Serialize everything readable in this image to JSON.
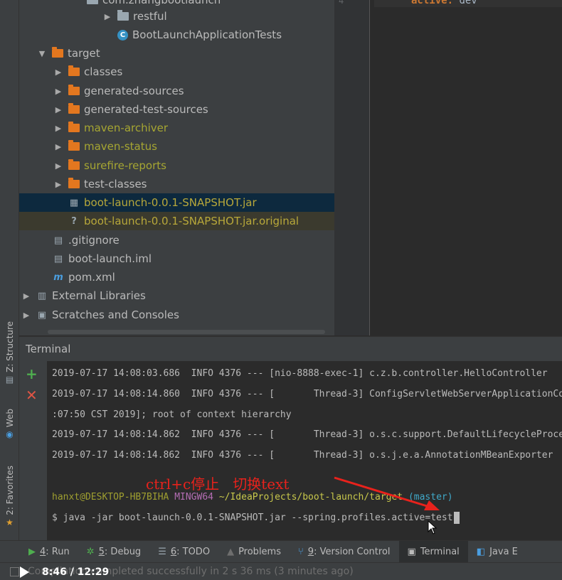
{
  "left_stripe": {
    "structure_label": "Z: Structure",
    "web_label": "Web",
    "favorites_label": "2: Favorites"
  },
  "project_tree": {
    "partial_top_row": "com.zhangbootlaunch",
    "rows": [
      {
        "label": "restful",
        "arrow": "▶",
        "icon": "package",
        "style": "normal"
      },
      {
        "label": "BootLaunchApplicationTests",
        "arrow": "",
        "icon": "class",
        "style": "normal"
      },
      {
        "label": "target",
        "arrow": "▼",
        "icon": "folder-orange",
        "style": "normal"
      },
      {
        "label": "classes",
        "arrow": "▶",
        "icon": "folder-orange",
        "style": "normal"
      },
      {
        "label": "generated-sources",
        "arrow": "▶",
        "icon": "folder-orange",
        "style": "normal"
      },
      {
        "label": "generated-test-sources",
        "arrow": "▶",
        "icon": "folder-orange",
        "style": "normal"
      },
      {
        "label": "maven-archiver",
        "arrow": "▶",
        "icon": "folder-orange",
        "style": "ignored"
      },
      {
        "label": "maven-status",
        "arrow": "▶",
        "icon": "folder-orange",
        "style": "ignored"
      },
      {
        "label": "surefire-reports",
        "arrow": "▶",
        "icon": "folder-orange",
        "style": "ignored"
      },
      {
        "label": "test-classes",
        "arrow": "▶",
        "icon": "folder-orange",
        "style": "normal"
      },
      {
        "label": "boot-launch-0.0.1-SNAPSHOT.jar",
        "arrow": "",
        "icon": "jar",
        "style": "selected"
      },
      {
        "label": "boot-launch-0.0.1-SNAPSHOT.jar.original",
        "arrow": "",
        "icon": "unknown-file",
        "style": "ignored-sel"
      },
      {
        "label": ".gitignore",
        "arrow": "",
        "icon": "text-file",
        "style": "normal"
      },
      {
        "label": "boot-launch.iml",
        "arrow": "",
        "icon": "iml-file",
        "style": "normal"
      },
      {
        "label": "pom.xml",
        "arrow": "",
        "icon": "maven",
        "style": "normal"
      },
      {
        "label": "External Libraries",
        "arrow": "▶",
        "icon": "libraries",
        "style": "normal"
      },
      {
        "label": "Scratches and Consoles",
        "arrow": "▶",
        "icon": "scratches",
        "style": "normal"
      }
    ]
  },
  "editor": {
    "line_number": "4",
    "code_key": "active:",
    "code_value": " dev"
  },
  "terminal": {
    "title": "Terminal",
    "lines": [
      "2019-07-17 14:08:03.686  INFO 4376 --- [nio-8888-exec-1] c.z.b.controller.HelloController",
      "2019-07-17 14:08:14.860  INFO 4376 --- [       Thread-3] ConfigServletWebServerApplicationContext",
      ":07:50 CST 2019]; root of context hierarchy",
      "2019-07-17 14:08:14.862  INFO 4376 --- [       Thread-3] o.s.c.support.DefaultLifecycleProcessor",
      "2019-07-17 14:08:14.862  INFO 4376 --- [       Thread-3] o.s.j.e.a.AnnotationMBeanExporter"
    ],
    "prompt": {
      "user_host": "hanxt@DESKTOP-HB7BIHA",
      "shell": "MINGW64",
      "path": "~/IdeaProjects/boot-launch/target",
      "branch": "(master)"
    },
    "command": "$ java -jar boot-launch-0.0.1-SNAPSHOT.jar --spring.profiles.active=test"
  },
  "annotation": {
    "text": "ctrl+c停止   切换text",
    "color": "#e8221c"
  },
  "bottom_tabs": [
    {
      "num": "4",
      "label": ": Run",
      "icon": "run-icon"
    },
    {
      "num": "5",
      "label": ": Debug",
      "icon": "debug-icon"
    },
    {
      "num": "6",
      "label": ": TODO",
      "icon": "todo-icon"
    },
    {
      "num": "",
      "label": "Problems",
      "icon": "problems-icon"
    },
    {
      "num": "9",
      "label": ": Version Control",
      "icon": "vcs-icon"
    },
    {
      "num": "",
      "label": "Terminal",
      "icon": "terminal-icon"
    },
    {
      "num": "",
      "label": "Java E",
      "icon": "java-icon"
    }
  ],
  "status_bar": {
    "message": "Compilation completed successfully in 2 s 36 ms (3 minutes ago)"
  },
  "video": {
    "time": "8:46 / 12:29"
  }
}
